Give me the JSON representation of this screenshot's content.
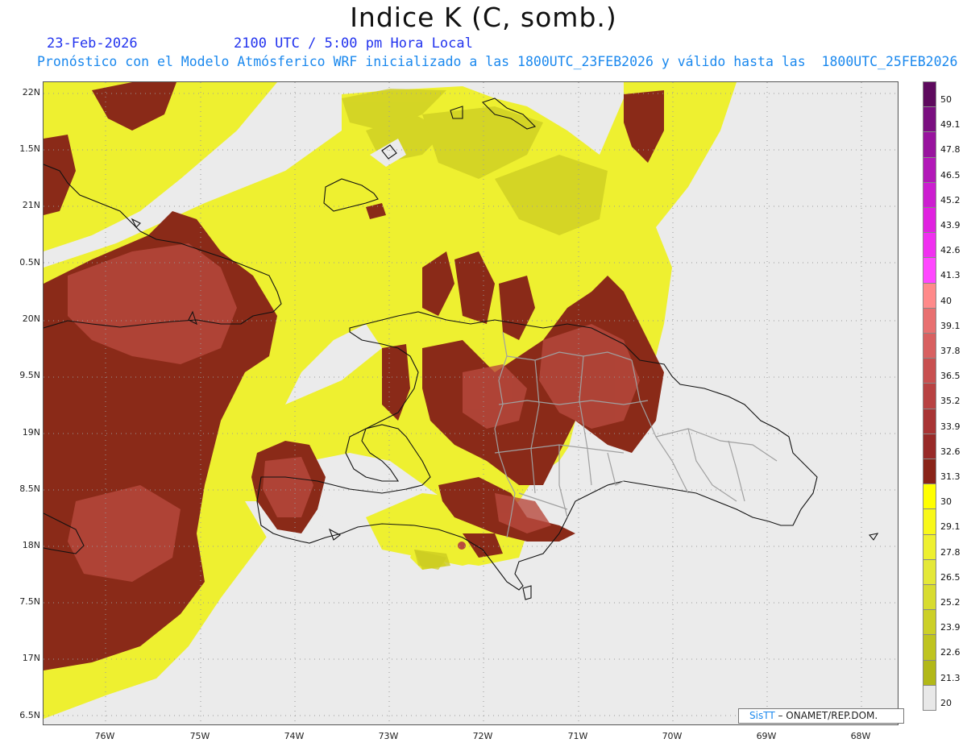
{
  "title": "Indice K (C, somb.)",
  "date": "23-Feb-2026",
  "time": "2100 UTC / 5:00 pm Hora Local",
  "forecast_info": "Pronóstico con el Modelo Atmósferico WRF inicializado a las 1800UTC_23FEB2026 y válido hasta las  1800UTC_25FEB2026",
  "lat_labels": [
    "22N",
    "1.5N",
    "21N",
    "0.5N",
    "20N",
    "9.5N",
    "19N",
    "8.5N",
    "18N",
    "7.5N",
    "17N",
    "6.5N"
  ],
  "lon_labels": [
    "76W",
    "75W",
    "74W",
    "73W",
    "72W",
    "71W",
    "70W",
    "69W",
    "68W"
  ],
  "colorbar": {
    "labels": [
      "50",
      "49.1",
      "47.8",
      "46.5",
      "45.2",
      "43.9",
      "42.6",
      "41.3",
      "40",
      "39.1",
      "37.8",
      "36.5",
      "35.2",
      "33.9",
      "32.6",
      "31.3",
      "30",
      "29.1",
      "27.8",
      "26.5",
      "25.2",
      "23.9",
      "22.6",
      "21.3",
      "20"
    ],
    "colors": [
      "#5e0a5e",
      "#7a0f80",
      "#98139e",
      "#b218b8",
      "#cc1ed0",
      "#e022e0",
      "#f030f0",
      "#ff48ff",
      "#ff8a8a",
      "#e87070",
      "#d86060",
      "#c85050",
      "#b84242",
      "#a83434",
      "#982a28",
      "#8a2418",
      "#ffff00",
      "#f8f81a",
      "#eef030",
      "#e4e838",
      "#d8dc30",
      "#ccd028",
      "#bfc420",
      "#b2b818",
      "#e8e8e8"
    ]
  },
  "credit": {
    "brand": "SisTT",
    "text": " – ONAMET/REP.DOM."
  }
}
